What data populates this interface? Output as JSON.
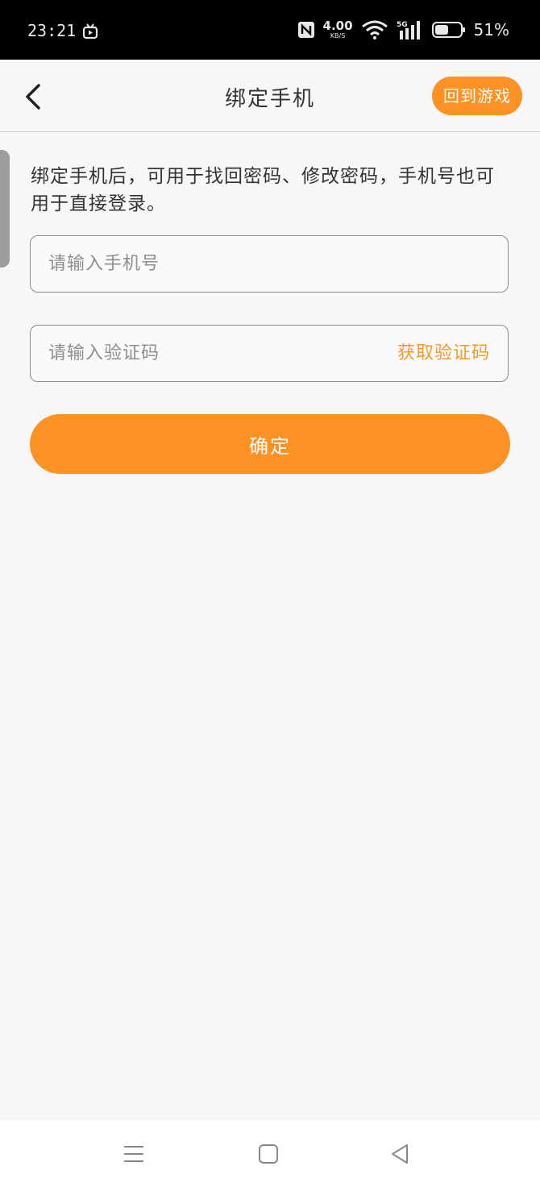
{
  "status_bar": {
    "time": "23:21",
    "net_speed_value": "4.00",
    "net_speed_unit": "KB/S",
    "signal_label": "5G",
    "battery_percent": "51%",
    "icons": [
      "tv-icon",
      "nfc-icon",
      "wifi-icon",
      "signal-icon",
      "battery-icon"
    ]
  },
  "header": {
    "title": "绑定手机",
    "return_label": "回到游戏"
  },
  "description": "绑定手机后，可用于找回密码、修改密码，手机号也可用于直接登录。",
  "form": {
    "phone_placeholder": "请输入手机号",
    "code_placeholder": "请输入验证码",
    "get_code_label": "获取验证码",
    "confirm_label": "确定"
  },
  "nav_bar": {
    "icons": [
      "menu-icon",
      "home-icon",
      "back-triangle-icon"
    ]
  },
  "colors": {
    "accent": "#fc9124",
    "link": "#f49a2a",
    "background": "#f7f7fa"
  }
}
